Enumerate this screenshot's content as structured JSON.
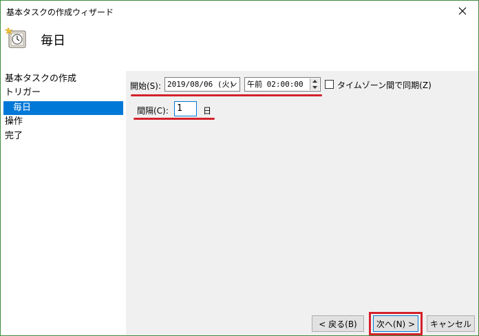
{
  "window": {
    "title": "基本タスクの作成ウィザード"
  },
  "header": {
    "title": "毎日"
  },
  "sidebar": {
    "items": [
      {
        "label": "基本タスクの作成",
        "active": false
      },
      {
        "label": "トリガー",
        "active": false
      },
      {
        "label": "毎日",
        "active": true
      },
      {
        "label": "操作",
        "active": false
      },
      {
        "label": "完了",
        "active": false
      }
    ]
  },
  "form": {
    "start_label": "開始(S):",
    "start_date": "2019/08/06 (火)",
    "start_time": "午前 02:00:00",
    "sync_timezone_label": "タイムゾーン間で同期(Z)",
    "sync_timezone_checked": false,
    "interval_label": "間隔(C):",
    "interval_value": "1",
    "interval_unit": "日"
  },
  "buttons": {
    "back": "< 戻る(B)",
    "next": "次へ(N) >",
    "cancel": "キャンセル"
  },
  "colors": {
    "accent": "#0078d7",
    "highlight_red": "#d4202a",
    "panel_bg": "#f0f0f0"
  }
}
